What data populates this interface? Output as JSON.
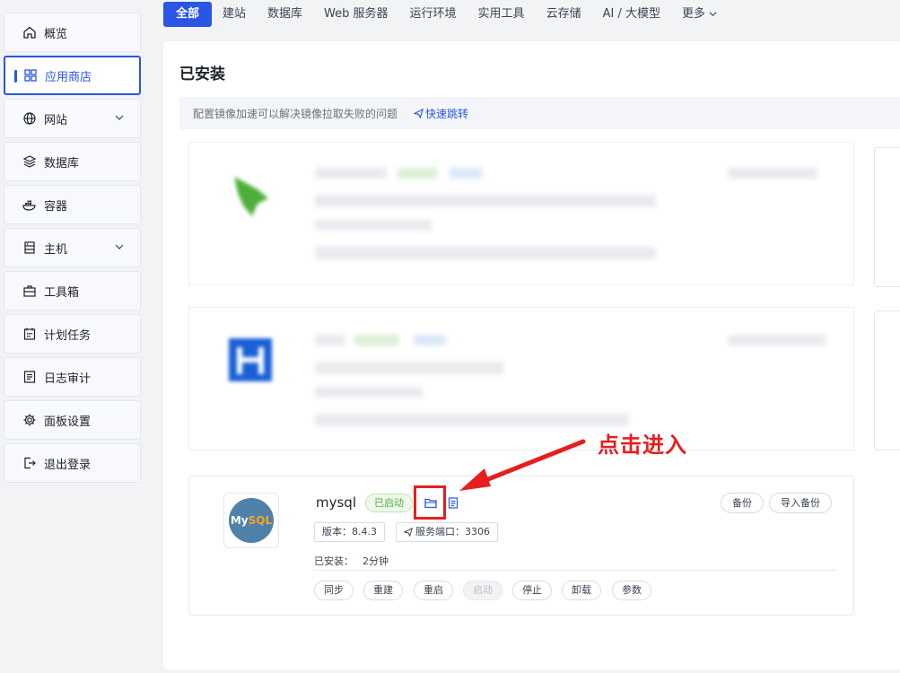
{
  "sidebar": {
    "items": [
      {
        "label": "概览",
        "icon": "home-icon"
      },
      {
        "label": "应用商店",
        "icon": "grid-icon"
      },
      {
        "label": "网站",
        "icon": "globe-icon"
      },
      {
        "label": "数据库",
        "icon": "layers-icon"
      },
      {
        "label": "容器",
        "icon": "docker-icon"
      },
      {
        "label": "主机",
        "icon": "server-icon"
      },
      {
        "label": "工具箱",
        "icon": "toolbox-icon"
      },
      {
        "label": "计划任务",
        "icon": "calendar-icon"
      },
      {
        "label": "日志审计",
        "icon": "log-icon"
      },
      {
        "label": "面板设置",
        "icon": "gear-icon"
      },
      {
        "label": "退出登录",
        "icon": "logout-icon"
      }
    ]
  },
  "tabs": [
    "全部",
    "建站",
    "数据库",
    "Web 服务器",
    "运行环境",
    "实用工具",
    "云存储",
    "AI / 大模型",
    "更多"
  ],
  "page": {
    "title": "已安装",
    "notice": "配置镜像加速可以解决镜像拉取失败的问题",
    "notice_link": "快速跳转"
  },
  "app": {
    "name": "mysql",
    "status": "已启动",
    "logo_text_1": "My",
    "logo_text_2": "SQL",
    "backup": "备份",
    "import_backup": "导入备份",
    "version": "版本：8.4.3",
    "port": "服务端口：3306",
    "installed_label": "已安装：",
    "installed_value": "2分钟",
    "actions": [
      "同步",
      "重建",
      "重启",
      "启动",
      "停止",
      "卸载",
      "参数"
    ]
  },
  "annotation": {
    "text": "点击进入"
  },
  "colors": {
    "accent": "#2a55e5",
    "annotation_red": "#e61e1e",
    "status_green": "#52b043"
  }
}
